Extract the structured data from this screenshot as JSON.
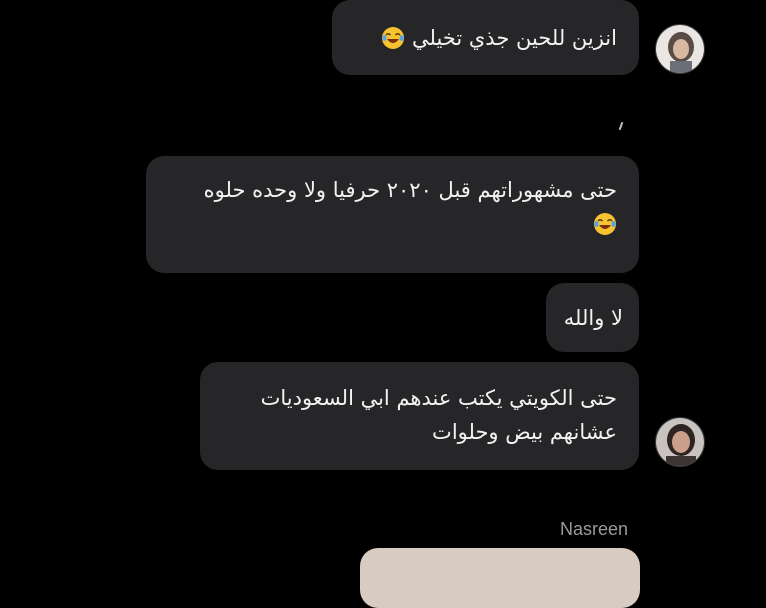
{
  "messages": [
    {
      "lines": [
        "انزين للحين جذي تخيلي"
      ],
      "emoji": "face-with-tears-of-joy"
    },
    {
      "lines": [
        "حتى مشهوراتهم قبل ٢٠٢٠ حرفيا ولا وحده حلوه"
      ],
      "emoji": "face-with-tears-of-joy"
    },
    {
      "lines": [
        "لا والله"
      ]
    },
    {
      "lines": [
        "حتى الكويتي يكتب عندهم ابي السعوديات",
        "عشانهم بيض وحلوات"
      ]
    }
  ],
  "next_sender": {
    "name": "Nasreen"
  },
  "colors": {
    "background": "#000000",
    "bubble": "#262628",
    "text": "#f2f2f2",
    "sender_name": "#9a9a9a"
  }
}
